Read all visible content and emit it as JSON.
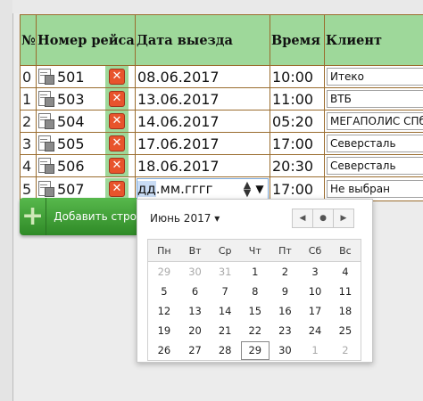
{
  "headers": {
    "idx": "№",
    "flight": "Номер рейса",
    "date": "Дата выезда",
    "time": "Время",
    "client": "Клиент"
  },
  "rows": [
    {
      "idx": "0",
      "flight": "501",
      "date": "08.06.2017",
      "time": "10:00",
      "client": "Итеко"
    },
    {
      "idx": "1",
      "flight": "503",
      "date": "13.06.2017",
      "time": "11:00",
      "client": "ВТБ"
    },
    {
      "idx": "2",
      "flight": "504",
      "date": "14.06.2017",
      "time": "05:20",
      "client": "МЕГАПОЛИС СПб"
    },
    {
      "idx": "3",
      "flight": "505",
      "date": "17.06.2017",
      "time": "17:00",
      "client": "Северсталь"
    },
    {
      "idx": "4",
      "flight": "506",
      "date": "18.06.2017",
      "time": "20:30",
      "client": "Северсталь"
    },
    {
      "idx": "5",
      "flight": "507",
      "date_input": {
        "dd": "дд",
        "mm": "мм",
        "yyyy": "гггг"
      },
      "time": "17:00",
      "client": "Не выбран"
    }
  ],
  "icons": {
    "delete": "close-icon",
    "edit": "document-edit-icon",
    "add": "plus-icon"
  },
  "add_button": {
    "label": "Добавить стро"
  },
  "datepicker": {
    "month_label": "Июнь 2017",
    "weekdays": [
      "Пн",
      "Вт",
      "Ср",
      "Чт",
      "Пт",
      "Сб",
      "Вс"
    ],
    "weeks": [
      [
        "29",
        "30",
        "31",
        "1",
        "2",
        "3",
        "4"
      ],
      [
        "5",
        "6",
        "7",
        "8",
        "9",
        "10",
        "11"
      ],
      [
        "12",
        "13",
        "14",
        "15",
        "16",
        "17",
        "18"
      ],
      [
        "19",
        "20",
        "21",
        "22",
        "23",
        "24",
        "25"
      ],
      [
        "26",
        "27",
        "28",
        "29",
        "30",
        "1",
        "2"
      ]
    ],
    "muted": [
      [
        0,
        0
      ],
      [
        0,
        1
      ],
      [
        0,
        2
      ],
      [
        4,
        5
      ],
      [
        4,
        6
      ]
    ],
    "today": [
      4,
      3
    ]
  },
  "colors": {
    "header_bg": "#9ed89a",
    "border": "#9a6c2e",
    "delete": "#e8542c",
    "add_button": "#3f9e36"
  }
}
